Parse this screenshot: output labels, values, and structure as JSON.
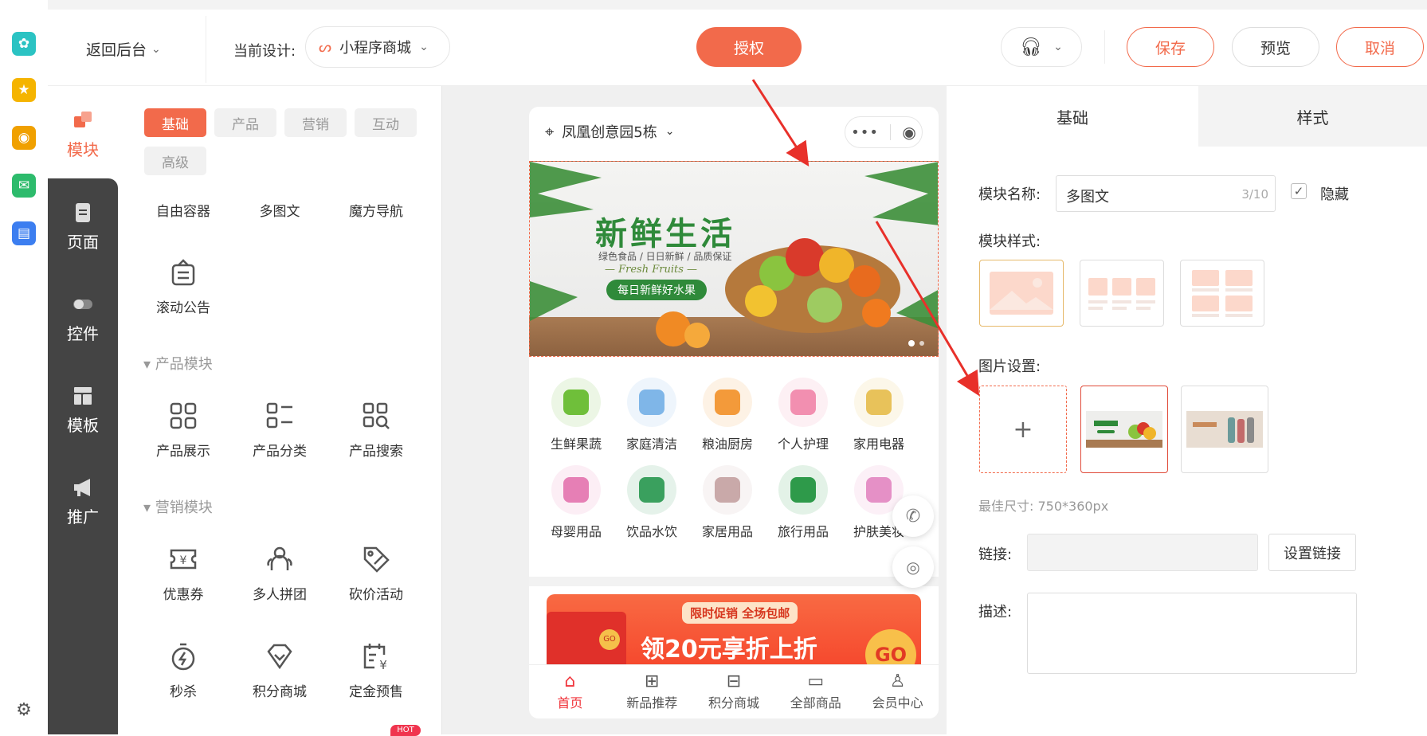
{
  "apps": [
    "app-icon-1",
    "star-icon",
    "weibo-icon",
    "mail-icon",
    "doc-icon"
  ],
  "topbar": {
    "back_label": "返回后台",
    "current_design_label": "当前设计:",
    "design_name": "小程序商城",
    "authorize_label": "授权",
    "save_label": "保存",
    "preview_label": "预览",
    "cancel_label": "取消"
  },
  "left_nav": [
    {
      "label": "模块"
    },
    {
      "label": "页面"
    },
    {
      "label": "控件"
    },
    {
      "label": "模板"
    },
    {
      "label": "推广"
    }
  ],
  "module_tabs": [
    "基础",
    "产品",
    "营销",
    "互动",
    "高级"
  ],
  "basic_widgets": [
    "自由容器",
    "多图文",
    "魔方导航",
    "滚动公告"
  ],
  "product_section": "产品模块",
  "product_widgets": [
    "产品展示",
    "产品分类",
    "产品搜索"
  ],
  "marketing_section": "营销模块",
  "marketing_widgets": [
    "优惠券",
    "多人拼团",
    "砍价活动",
    "秒杀",
    "积分商城",
    "定金预售"
  ],
  "hot_badge": "HOT",
  "phone": {
    "location": "凤凰创意园5栋",
    "banner": {
      "title": "新鲜生活",
      "subtitle": "绿色食品 / 日日新鲜 / 品质保证",
      "english": "— Fresh Fruits —",
      "tagline": "每日新鲜好水果"
    },
    "categories": [
      {
        "label": "生鲜果蔬",
        "color": "#6fbf3a"
      },
      {
        "label": "家庭清洁",
        "color": "#7fb6e8"
      },
      {
        "label": "粮油厨房",
        "color": "#f39a3a"
      },
      {
        "label": "个人护理",
        "color": "#f28fb0"
      },
      {
        "label": "家用电器",
        "color": "#e8c25a"
      },
      {
        "label": "母婴用品",
        "color": "#e67fb5"
      },
      {
        "label": "饮品水饮",
        "color": "#3aa05e"
      },
      {
        "label": "家居用品",
        "color": "#c9a9a9"
      },
      {
        "label": "旅行用品",
        "color": "#2e9a4a"
      },
      {
        "label": "护肤美妆",
        "color": "#e590c6"
      }
    ],
    "promo": {
      "top": "限时促销 全场包邮",
      "main": "领20元享折上折",
      "go": "GO"
    },
    "tabbar": [
      "首页",
      "新品推荐",
      "积分商城",
      "全部商品",
      "会员中心"
    ]
  },
  "right": {
    "tab_basic": "基础",
    "tab_style": "样式",
    "module_name_label": "模块名称:",
    "module_name_value": "多图文",
    "module_name_count": "3/10",
    "hide_label": "隐藏",
    "module_style_label": "模块样式:",
    "image_setting_label": "图片设置:",
    "best_size": "最佳尺寸: 750*360px",
    "link_label": "链接:",
    "set_link_label": "设置链接",
    "desc_label": "描述:"
  },
  "colors": {
    "accent": "#f26a4b",
    "nav_dark": "#444444"
  }
}
